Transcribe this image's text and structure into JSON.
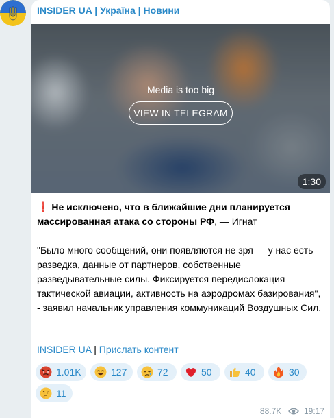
{
  "channel": {
    "name": "INSIDER UA | Україна | Новини"
  },
  "media": {
    "notice": "Media is too big",
    "button_label": "VIEW IN TELEGRAM",
    "duration": "1:30"
  },
  "post": {
    "headline_emoji": "❗",
    "headline_bold": "Не исключено, что в ближайшие дни планируется массированная атака со стороны РФ",
    "headline_tail": ", — Игнат",
    "quote": "\"Было много сообщений, они появляются не зря — у нас есть разведка, данные от партнеров, собственные разведывательные силы. Фиксируется передислокация тактической авиации, активность на аэродромах базирования\", - заявил начальник управления коммуникаций Воздушных Сил."
  },
  "footer_links": {
    "channel_link": "INSIDER UA",
    "separator": "|",
    "submit_link": "Прислать контент"
  },
  "reactions": [
    {
      "icon": "angry-face-icon",
      "count": "1.01K"
    },
    {
      "icon": "grinning-face-icon",
      "count": "127"
    },
    {
      "icon": "crying-face-icon",
      "count": "72"
    },
    {
      "icon": "red-heart-icon",
      "count": "50"
    },
    {
      "icon": "thumbs-up-icon",
      "count": "40"
    },
    {
      "icon": "fire-icon",
      "count": "30"
    },
    {
      "icon": "thinking-face-icon",
      "count": "11"
    }
  ],
  "meta": {
    "views": "88.7K",
    "time": "19:17"
  },
  "colors": {
    "accent": "#2a89c8",
    "reaction_bg": "#e4f0f9",
    "background": "#e9eef1"
  }
}
